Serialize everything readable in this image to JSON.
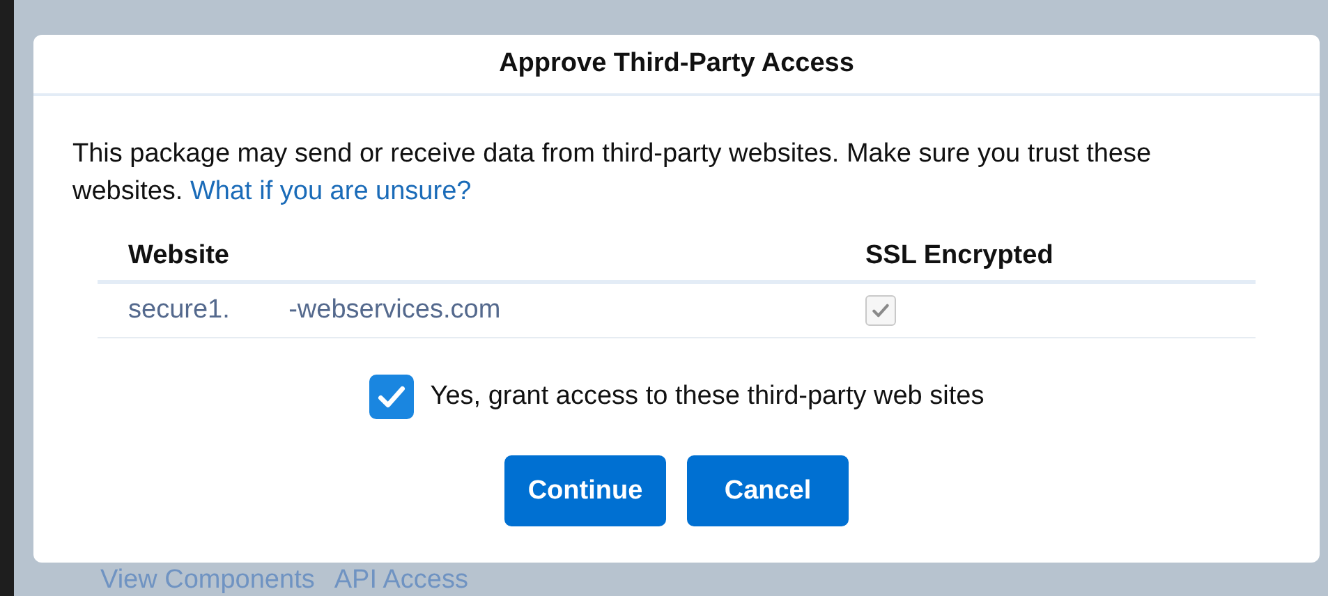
{
  "background": {
    "links": [
      "View Components",
      "API Access"
    ]
  },
  "dialog": {
    "title": "Approve Third-Party Access",
    "message": "This package may send or receive data from third-party websites. Make sure you trust these websites.",
    "help_link": "What if you are unsure?",
    "table": {
      "columns": [
        "Website",
        "SSL Encrypted"
      ],
      "rows": [
        {
          "website": "secure1.        -webservices.com",
          "ssl_encrypted": true
        }
      ]
    },
    "consent": {
      "label": "Yes, grant access to these third-party web sites",
      "checked": true
    },
    "buttons": [
      "Continue",
      "Cancel"
    ]
  }
}
